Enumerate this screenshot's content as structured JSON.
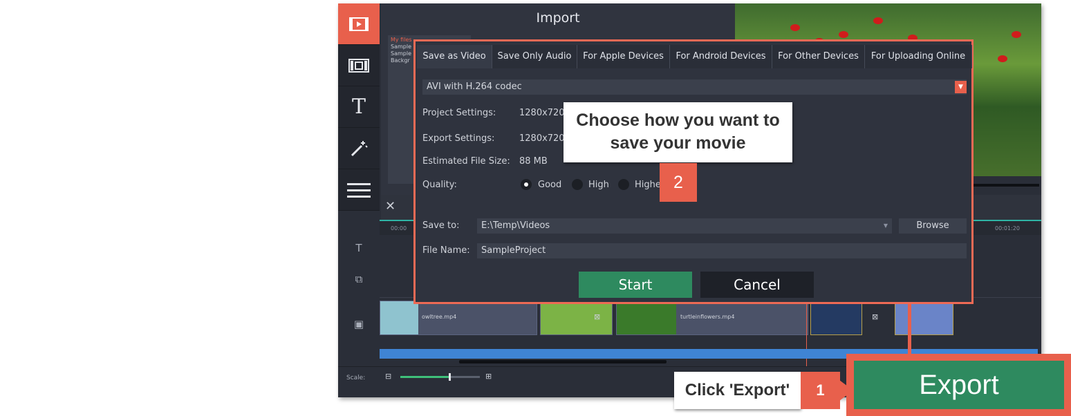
{
  "import_panel": {
    "title": "Import",
    "files": [
      "My files",
      "Sample",
      "Sample",
      "Backgr"
    ]
  },
  "sidebar": {
    "items": [
      {
        "icon": "import-icon",
        "active": true
      },
      {
        "icon": "filters-icon",
        "active": false
      },
      {
        "icon": "titles-icon",
        "active": false
      },
      {
        "icon": "magic-wand-icon",
        "active": false
      },
      {
        "icon": "menu-icon",
        "active": false
      }
    ]
  },
  "timeline": {
    "ruler_start": "00:00",
    "ruler_end": "00:01:20",
    "clips": [
      {
        "name": "owltree.mp4"
      },
      {
        "name": "turtleinflowers.mp4"
      }
    ],
    "scale_label": "Scale:"
  },
  "export_dialog": {
    "tabs": [
      "Save as Video",
      "Save Only Audio",
      "For Apple Devices",
      "For Android Devices",
      "For Other Devices",
      "For Uploading Online"
    ],
    "active_tab": 0,
    "format": "AVI with H.264 codec",
    "project_settings_label": "Project Settings:",
    "project_settings_value": "1280x720",
    "export_settings_label": "Export Settings:",
    "export_settings_value": "1280x720",
    "file_size_label": "Estimated File Size:",
    "file_size_value": "88 MB",
    "quality_label": "Quality:",
    "quality_options": [
      "Good",
      "High",
      "Highe"
    ],
    "quality_selected": "Good",
    "save_to_label": "Save to:",
    "save_to_value": "E:\\Temp\\Videos",
    "browse_label": "Browse",
    "file_name_label": "File Name:",
    "file_name_value": "SampleProject",
    "start_label": "Start",
    "cancel_label": "Cancel"
  },
  "callouts": {
    "step2_text": "Choose how you want to save your movie",
    "step2_number": "2",
    "step1_text": "Click 'Export'",
    "step1_number": "1"
  },
  "export_button_label": "Export",
  "colors": {
    "accent": "#e8604c",
    "dialog_border": "#ee6a55",
    "start_green": "#2e8a5f",
    "export_green": "#2e8a5f",
    "timeline_blue": "#3f84d4",
    "teal_line": "#2fb4a5"
  }
}
